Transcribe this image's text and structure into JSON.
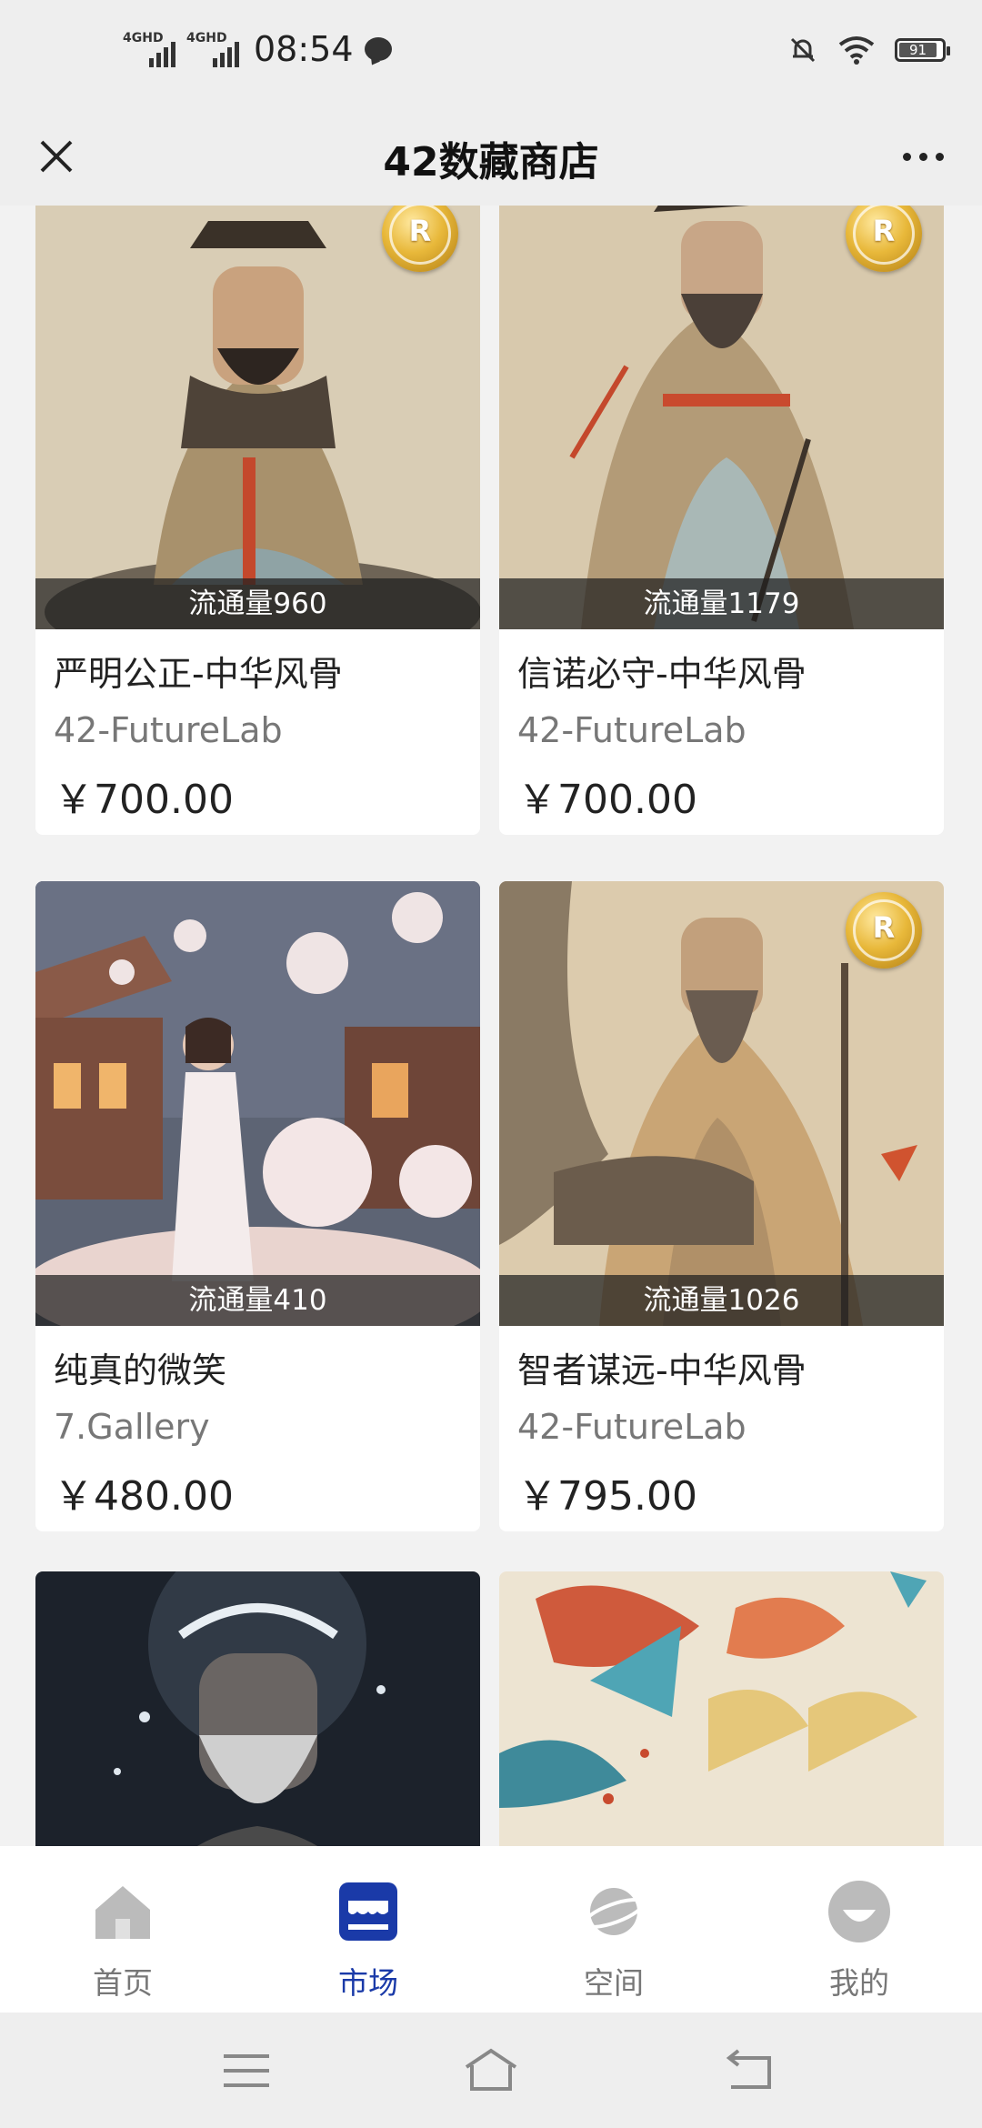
{
  "status_bar": {
    "network1": "4GHD",
    "network2": "4GHD",
    "time": "08:54",
    "battery": "91"
  },
  "header": {
    "title": "42数藏商店"
  },
  "products": [
    {
      "name": "严明公正-中华风骨",
      "brand": "42-FutureLab",
      "price": "￥700.00",
      "circulation": "流通量960",
      "badge": "R"
    },
    {
      "name": "信诺必守-中华风骨",
      "brand": "42-FutureLab",
      "price": "￥700.00",
      "circulation": "流通量1179",
      "badge": "R"
    },
    {
      "name": "纯真的微笑",
      "brand": "7.Gallery",
      "price": "￥480.00",
      "circulation": "流通量410",
      "badge": ""
    },
    {
      "name": "智者谋远-中华风骨",
      "brand": "42-FutureLab",
      "price": "￥795.00",
      "circulation": "流通量1026",
      "badge": "R"
    }
  ],
  "tabbar": {
    "items": [
      {
        "label": "首页",
        "icon": "home-icon",
        "active": false
      },
      {
        "label": "市场",
        "icon": "shop-icon",
        "active": true
      },
      {
        "label": "空间",
        "icon": "planet-icon",
        "active": false
      },
      {
        "label": "我的",
        "icon": "profile-icon",
        "active": false
      }
    ]
  },
  "colors": {
    "accent": "#1a3aa8",
    "inactive": "#bbbbbb"
  }
}
